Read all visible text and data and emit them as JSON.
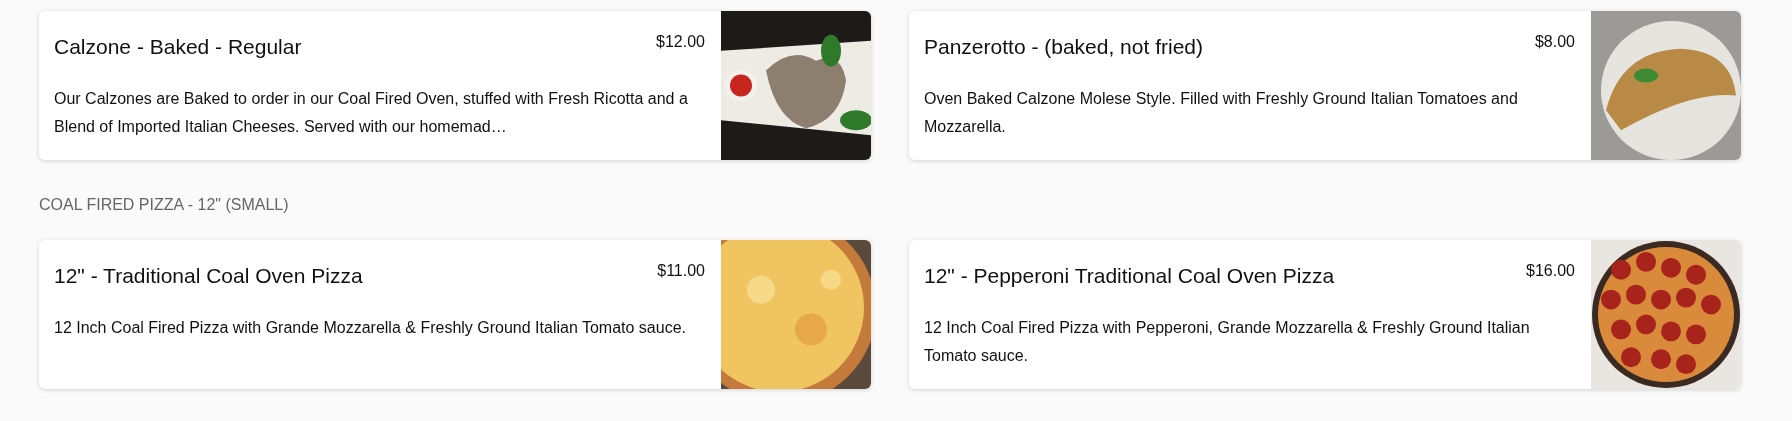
{
  "sections": [
    {
      "items": [
        {
          "name": "Calzone - Baked - Regular",
          "price": "$12.00",
          "description": "Our Calzones are Baked to order in our Coal Fired Oven, stuffed with Fresh Ricotta and a Blend of Imported Italian Cheeses. Served with our homemad…"
        },
        {
          "name": "Panzerotto - (baked, not fried)",
          "price": "$8.00",
          "description": "Oven Baked Calzone Molese Style. Filled with Freshly Ground Italian Tomatoes and Mozzarella."
        }
      ]
    },
    {
      "heading": "COAL FIRED PIZZA - 12\" (SMALL)",
      "items": [
        {
          "name": "12\" - Traditional Coal Oven Pizza",
          "price": "$11.00",
          "description": "12 Inch Coal Fired Pizza with Grande Mozzarella & Freshly Ground Italian Tomato sauce."
        },
        {
          "name": "12\" - Pepperoni Traditional Coal Oven Pizza",
          "price": "$16.00",
          "description": "12 Inch Coal Fired Pizza with Pepperoni, Grande Mozzarella & Freshly Ground Italian Tomato sauce."
        }
      ]
    }
  ]
}
